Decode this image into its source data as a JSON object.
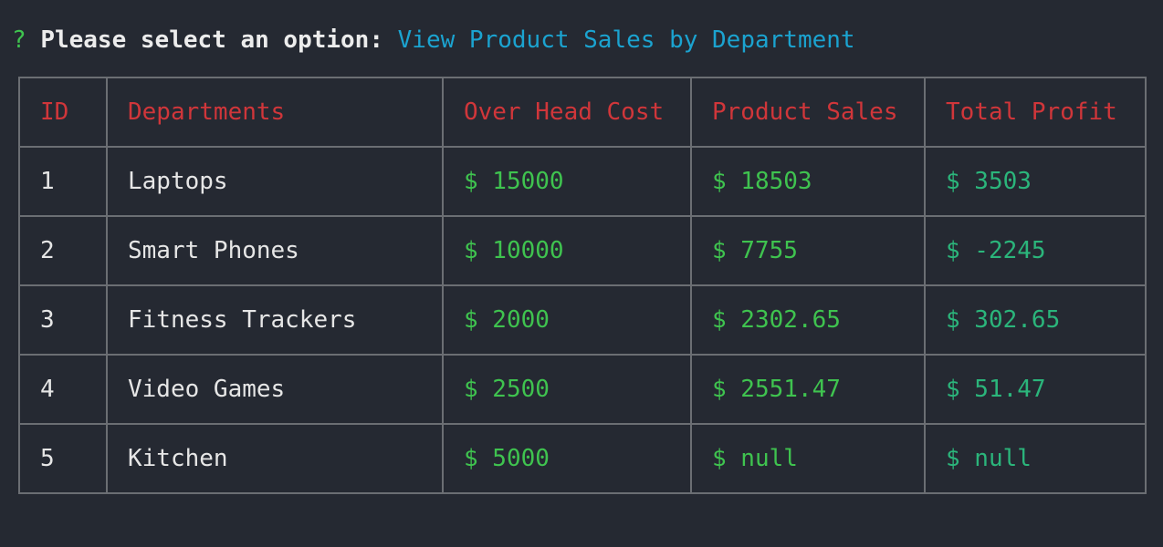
{
  "prompt": {
    "marker": "?",
    "label": "Please select an option:",
    "answer": "View Product Sales by Department"
  },
  "table": {
    "headers": [
      "ID",
      "Departments",
      "Over Head Cost",
      "Product Sales",
      "Total Profit"
    ],
    "rows": [
      {
        "id": "1",
        "department": "Laptops",
        "overhead": "$ 15000",
        "sales": "$ 18503",
        "profit": "$ 3503"
      },
      {
        "id": "2",
        "department": "Smart Phones",
        "overhead": "$ 10000",
        "sales": "$ 7755",
        "profit": "$ -2245"
      },
      {
        "id": "3",
        "department": "Fitness Trackers",
        "overhead": "$ 2000",
        "sales": "$ 2302.65",
        "profit": "$ 302.65"
      },
      {
        "id": "4",
        "department": "Video Games",
        "overhead": "$ 2500",
        "sales": "$ 2551.47",
        "profit": "$ 51.47"
      },
      {
        "id": "5",
        "department": "Kitchen",
        "overhead": "$ 5000",
        "sales": "$ null",
        "profit": "$ null"
      }
    ]
  },
  "colors": {
    "background": "#252932",
    "header_text": "#d0363a",
    "money_text": "#3fc34f",
    "profit_text": "#2bb57b",
    "answer_text": "#1ba3d0",
    "border": "#6b6e73"
  }
}
